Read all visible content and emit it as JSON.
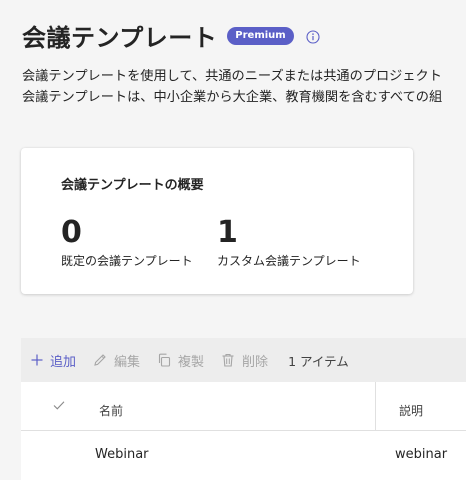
{
  "header": {
    "title": "会議テンプレート",
    "badge": "Premium",
    "info_icon": "info-icon"
  },
  "description": {
    "line1": "会議テンプレートを使用して、共通のニーズまたは共通のプロジェクト",
    "line2": "会議テンプレートは、中小企業から大企業、教育機関を含むすべての組"
  },
  "summary": {
    "title": "会議テンプレートの概要",
    "default_count": "0",
    "default_label": "既定の会議テンプレート",
    "custom_count": "1",
    "custom_label": "カスタム会議テンプレート"
  },
  "toolbar": {
    "add_label": "追加",
    "edit_label": "編集",
    "copy_label": "複製",
    "delete_label": "削除",
    "item_count": "1 アイテム"
  },
  "table": {
    "columns": {
      "name": "名前",
      "description": "説明"
    },
    "rows": [
      {
        "name": "Webinar",
        "description": "webinar"
      }
    ]
  },
  "colors": {
    "accent": "#5b5fc7",
    "disabled": "#a6a6a6",
    "background": "#f5f5f5"
  }
}
